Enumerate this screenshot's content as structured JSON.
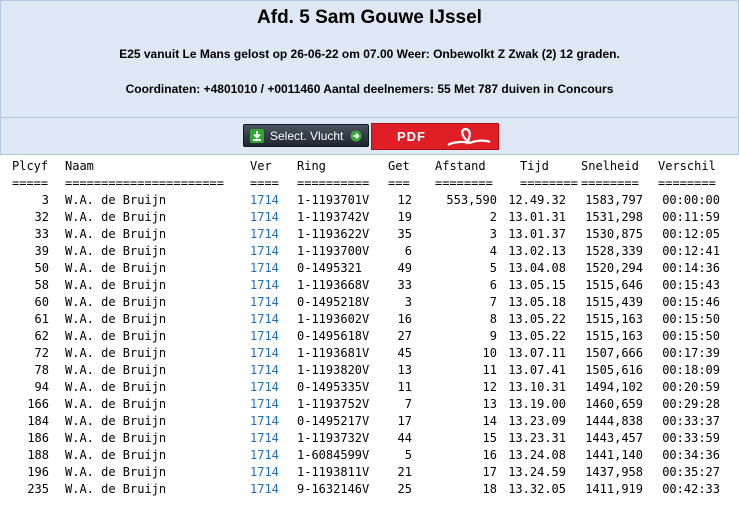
{
  "header": {
    "title": "Afd. 5 Sam Gouwe IJssel",
    "line1": "E25 vanuit Le Mans gelost op 26-06-22 om 07.00 Weer: Onbewolkt Z Zwak (2) 12 graden.",
    "line2": "Coordinaten: +4801010 / +0011460 Aantal deelnemers: 55 Met 787 duiven in Concours"
  },
  "toolbar": {
    "select_label": "Select. Vlucht",
    "pdf_label": "PDF",
    "select_icon": "download-icon",
    "arrow_icon": "arrow-right-icon",
    "pdf_icon": "acrobat-icon",
    "accent_colors": {
      "header_bg": "#dde8f4",
      "pdf_red": "#e01e26",
      "link_blue": "#1f6fb6"
    }
  },
  "table": {
    "headers": [
      "Plcyf",
      "Naam",
      "Ver",
      "Ring",
      "Get",
      "Afstand",
      "Tijd",
      "Snelheid",
      "Verschil"
    ],
    "separators": [
      "=====",
      "======================",
      "====",
      "==========",
      "===",
      "========",
      "========",
      "========",
      "========"
    ],
    "rows": [
      [
        "3",
        "W.A. de Bruijn",
        "1714",
        "1-1193701V",
        "12",
        "553,590",
        "12.49.32",
        "1583,797",
        "00:00:00"
      ],
      [
        "32",
        "W.A. de Bruijn",
        "1714",
        "1-1193742V",
        "19",
        "2",
        "13.01.31",
        "1531,298",
        "00:11:59"
      ],
      [
        "33",
        "W.A. de Bruijn",
        "1714",
        "1-1193622V",
        "35",
        "3",
        "13.01.37",
        "1530,875",
        "00:12:05"
      ],
      [
        "39",
        "W.A. de Bruijn",
        "1714",
        "1-1193700V",
        "6",
        "4",
        "13.02.13",
        "1528,339",
        "00:12:41"
      ],
      [
        "50",
        "W.A. de Bruijn",
        "1714",
        "0-1495321",
        "49",
        "5",
        "13.04.08",
        "1520,294",
        "00:14:36"
      ],
      [
        "58",
        "W.A. de Bruijn",
        "1714",
        "1-1193668V",
        "33",
        "6",
        "13.05.15",
        "1515,646",
        "00:15:43"
      ],
      [
        "60",
        "W.A. de Bruijn",
        "1714",
        "0-1495218V",
        "3",
        "7",
        "13.05.18",
        "1515,439",
        "00:15:46"
      ],
      [
        "61",
        "W.A. de Bruijn",
        "1714",
        "1-1193602V",
        "16",
        "8",
        "13.05.22",
        "1515,163",
        "00:15:50"
      ],
      [
        "62",
        "W.A. de Bruijn",
        "1714",
        "0-1495618V",
        "27",
        "9",
        "13.05.22",
        "1515,163",
        "00:15:50"
      ],
      [
        "72",
        "W.A. de Bruijn",
        "1714",
        "1-1193681V",
        "45",
        "10",
        "13.07.11",
        "1507,666",
        "00:17:39"
      ],
      [
        "78",
        "W.A. de Bruijn",
        "1714",
        "1-1193820V",
        "13",
        "11",
        "13.07.41",
        "1505,616",
        "00:18:09"
      ],
      [
        "94",
        "W.A. de Bruijn",
        "1714",
        "0-1495335V",
        "11",
        "12",
        "13.10.31",
        "1494,102",
        "00:20:59"
      ],
      [
        "166",
        "W.A. de Bruijn",
        "1714",
        "1-1193752V",
        "7",
        "13",
        "13.19.00",
        "1460,659",
        "00:29:28"
      ],
      [
        "184",
        "W.A. de Bruijn",
        "1714",
        "0-1495217V",
        "17",
        "14",
        "13.23.09",
        "1444,838",
        "00:33:37"
      ],
      [
        "186",
        "W.A. de Bruijn",
        "1714",
        "1-1193732V",
        "44",
        "15",
        "13.23.31",
        "1443,457",
        "00:33:59"
      ],
      [
        "188",
        "W.A. de Bruijn",
        "1714",
        "1-6084599V",
        "5",
        "16",
        "13.24.08",
        "1441,140",
        "00:34:36"
      ],
      [
        "196",
        "W.A. de Bruijn",
        "1714",
        "1-1193811V",
        "21",
        "17",
        "13.24.59",
        "1437,958",
        "00:35:27"
      ],
      [
        "235",
        "W.A. de Bruijn",
        "1714",
        "9-1632146V",
        "25",
        "18",
        "13.32.05",
        "1411,919",
        "00:42:33"
      ]
    ]
  }
}
